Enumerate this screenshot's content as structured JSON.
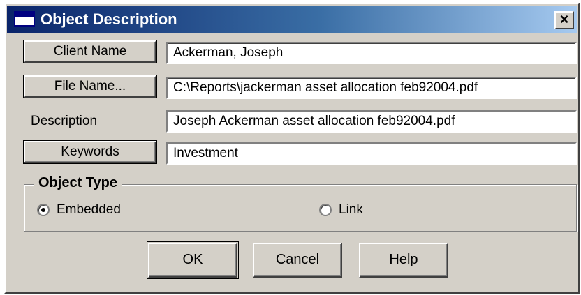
{
  "window": {
    "title": "Object Description",
    "close_label": "×"
  },
  "fields": {
    "client_name": {
      "label": "Client Name",
      "value": "Ackerman, Joseph"
    },
    "file_name": {
      "label": "File Name...",
      "value": "C:\\Reports\\jackerman asset allocation feb92004.pdf"
    },
    "description": {
      "label": "Description",
      "value": "Joseph Ackerman asset allocation feb92004.pdf"
    },
    "keywords": {
      "label": "Keywords",
      "value": "Investment"
    }
  },
  "object_type": {
    "legend": "Object Type",
    "options": [
      {
        "label": "Embedded",
        "selected": true
      },
      {
        "label": "Link",
        "selected": false
      }
    ]
  },
  "buttons": {
    "ok": "OK",
    "cancel": "Cancel",
    "help": "Help"
  },
  "colors": {
    "face": "#d4d0c8",
    "title_start": "#0a246a",
    "title_end": "#a6caf0"
  }
}
